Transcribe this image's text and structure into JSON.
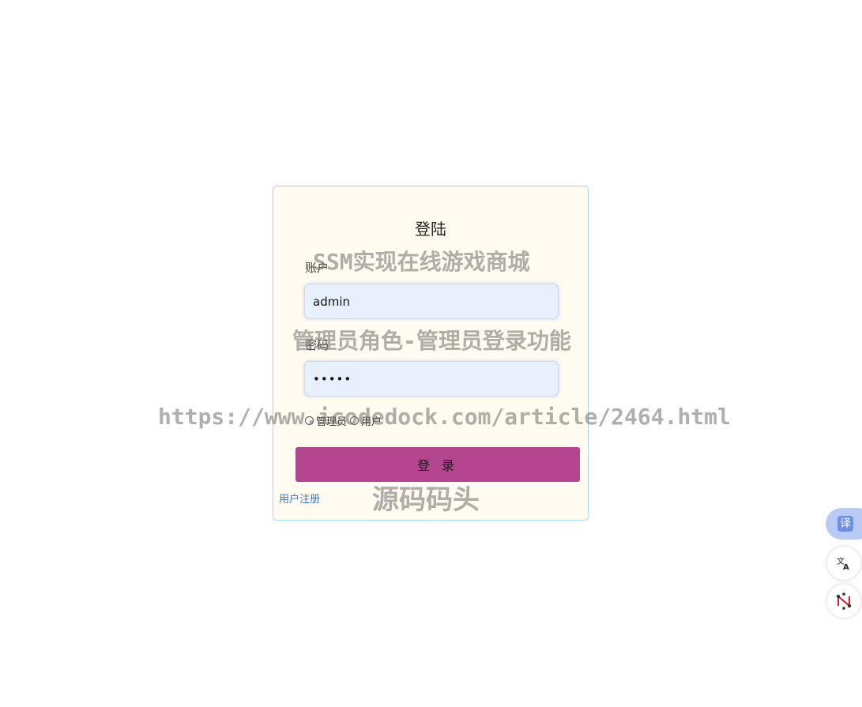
{
  "login": {
    "title": "登陆",
    "account_label": "账户",
    "account_value": "admin",
    "password_label": "密码",
    "password_value": "admin",
    "roles": [
      {
        "label": "管理员",
        "selected": false
      },
      {
        "label": "用户",
        "selected": false
      }
    ],
    "submit_label": "登 录",
    "register_link": "用户注册"
  },
  "watermark": {
    "line1": "SSM实现在线游戏商城",
    "line2": "管理员角色-管理员登录功能",
    "line3": "https://www.icodedock.com/article/2464.html",
    "line4": "源码码头"
  },
  "side_tools": {
    "translate_label": "译",
    "icons": [
      "translate-icon",
      "language-switch-icon",
      "network-node-icon"
    ]
  },
  "colors": {
    "card_background": "#fffbf0",
    "card_border": "#a9d5f2",
    "input_background": "#e8f0fe",
    "button_background": "#b3468e",
    "link": "#3f78b8"
  }
}
